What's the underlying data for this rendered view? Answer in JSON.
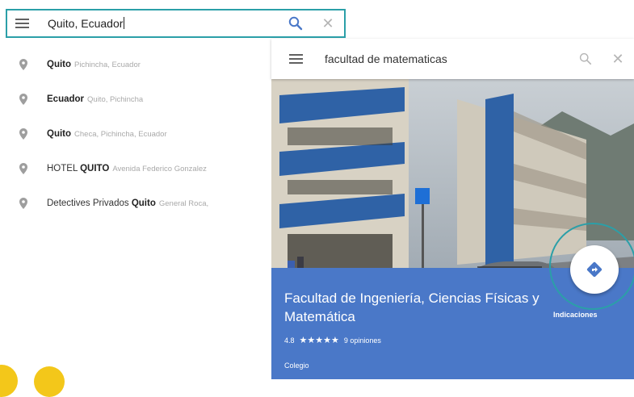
{
  "left_search": {
    "query": "Quito, Ecuador",
    "icons": {
      "menu": "hamburger-icon",
      "search": "search-icon",
      "clear": "close-icon"
    }
  },
  "suggestions": [
    {
      "main_bold": "Quito",
      "main_rest": "",
      "sub": "Pichincha, Ecuador"
    },
    {
      "main_bold": "Ecuador",
      "main_rest": "",
      "sub": "Quito, Pichincha"
    },
    {
      "main_bold": "Quito",
      "main_rest": "",
      "sub": "Checa, Pichincha, Ecuador"
    },
    {
      "main_pre": "HOTEL ",
      "main_bold": "QUITO",
      "main_rest": "",
      "sub": "Avenida Federico Gonzalez"
    },
    {
      "main_pre": "Detectives Privados ",
      "main_bold": "Quito",
      "main_rest": "",
      "sub": "General Roca,"
    }
  ],
  "place_card": {
    "search_query": "facultad de matematicas",
    "title": "Facultad de Ingeniería, Ciencias Físicas y Matemática",
    "rating": "4.8",
    "stars": "★★★★★",
    "reviews": "9 opiniones",
    "category": "Colegio",
    "directions_label": "Indicaciones"
  },
  "colors": {
    "highlight_outline": "#2b9fa8",
    "info_panel": "#4a78c8",
    "accent_icon": "#4a78c8",
    "decoration": "#f3c71a"
  }
}
